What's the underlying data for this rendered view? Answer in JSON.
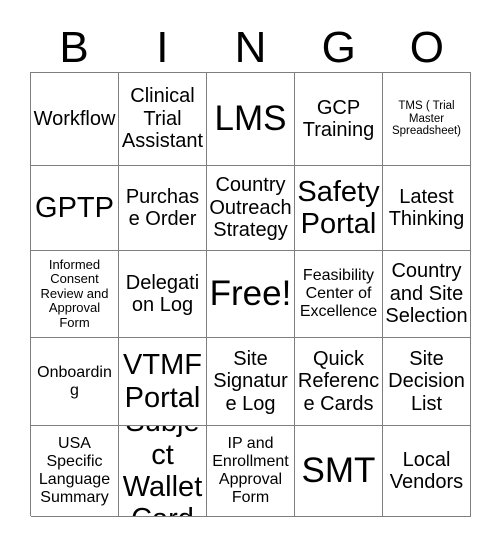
{
  "card": {
    "header_letters": [
      "B",
      "I",
      "N",
      "G",
      "O"
    ],
    "rows": [
      [
        {
          "label": "Workflow",
          "size": "md"
        },
        {
          "label": "Clinical Trial Assistant",
          "size": "md"
        },
        {
          "label": "LMS",
          "size": "xl"
        },
        {
          "label": "GCP Training",
          "size": "md"
        },
        {
          "label": "TMS ( Trial Master Spreadsheet)",
          "size": "xxs"
        }
      ],
      [
        {
          "label": "GPTP",
          "size": "lg"
        },
        {
          "label": "Purchase Order",
          "size": "md"
        },
        {
          "label": "Country Outreach Strategy",
          "size": "md"
        },
        {
          "label": "Safety Portal",
          "size": "lg"
        },
        {
          "label": "Latest Thinking",
          "size": "md"
        }
      ],
      [
        {
          "label": "Informed Consent Review and Approval Form",
          "size": "xs"
        },
        {
          "label": "Delegation Log",
          "size": "md"
        },
        {
          "label": "Free!",
          "size": "xl"
        },
        {
          "label": "Feasibility Center of Excellence",
          "size": "sm"
        },
        {
          "label": "Country and Site Selection",
          "size": "md"
        }
      ],
      [
        {
          "label": "Onboarding",
          "size": "sm"
        },
        {
          "label": "VTMF Portal",
          "size": "lg"
        },
        {
          "label": "Site Signature Log",
          "size": "md"
        },
        {
          "label": "Quick Reference Cards",
          "size": "md"
        },
        {
          "label": "Site Decision List",
          "size": "md"
        }
      ],
      [
        {
          "label": "USA Specific Language Summary",
          "size": "sm"
        },
        {
          "label": "Subject Wallet Card",
          "size": "lg"
        },
        {
          "label": "IP and Enrollment Approval Form",
          "size": "sm"
        },
        {
          "label": "SMT",
          "size": "xl"
        },
        {
          "label": "Local Vendors",
          "size": "md"
        }
      ]
    ]
  },
  "colors": {
    "background": "#ffffff",
    "text": "#000000",
    "grid_line": "#7f7f7f"
  }
}
